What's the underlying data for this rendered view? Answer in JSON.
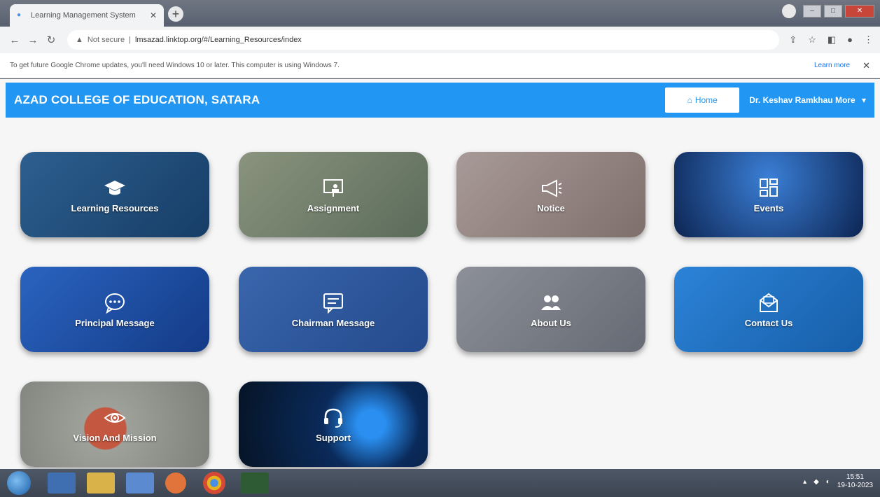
{
  "browser": {
    "tab_title": "Learning Management System",
    "url_security": "Not secure",
    "url": "lmsazad.linktop.org/#/Learning_Resources/index",
    "infobar_text": "To get future Google Chrome updates, you'll need Windows 10 or later. This computer is using Windows 7.",
    "infobar_link": "Learn more"
  },
  "header": {
    "brand": "AZAD COLLEGE OF EDUCATION, SATARA",
    "home_label": "Home",
    "user_name": "Dr. Keshav Ramkhau More"
  },
  "tiles": [
    {
      "label": "Learning Resources",
      "icon": "graduation-cap-icon",
      "color": "#1f4e79"
    },
    {
      "label": "Assignment",
      "icon": "presentation-icon",
      "color": "#6f7b6b"
    },
    {
      "label": "Notice",
      "icon": "megaphone-icon",
      "color": "#8a7a78"
    },
    {
      "label": "Events",
      "icon": "layout-icon",
      "color": "#123a7a"
    },
    {
      "label": "Principal Message",
      "icon": "chat-bubble-icon",
      "color": "#1c4fa0"
    },
    {
      "label": "Chairman Message",
      "icon": "message-icon",
      "color": "#2e5aa0"
    },
    {
      "label": "About Us",
      "icon": "users-icon",
      "color": "#7b7f88"
    },
    {
      "label": "Contact Us",
      "icon": "envelope-icon",
      "color": "#1f6dbc"
    },
    {
      "label": "Vision And Mission",
      "icon": "eye-icon",
      "color": "#8c8f8a"
    },
    {
      "label": "Support",
      "icon": "headset-icon",
      "color": "#0d1f3a"
    }
  ],
  "taskbar": {
    "time": "15:51",
    "date": "19-10-2023"
  }
}
